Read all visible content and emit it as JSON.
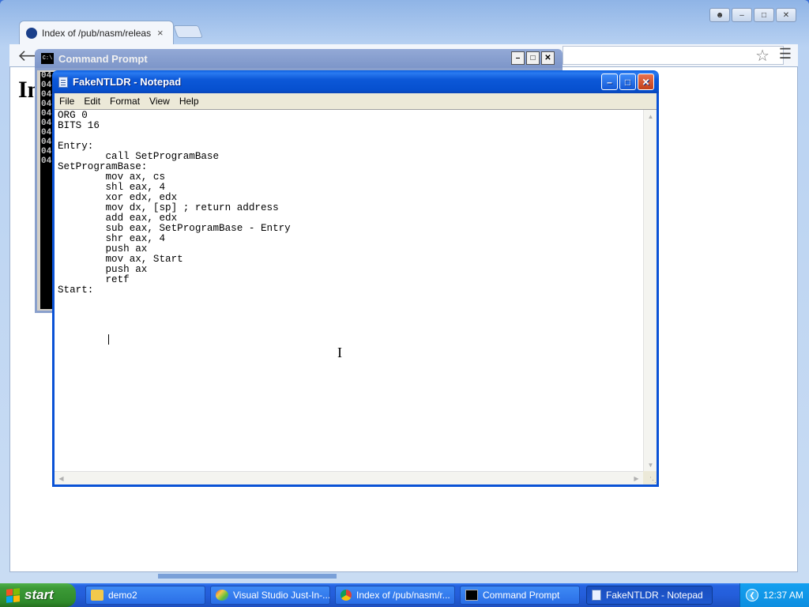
{
  "browser": {
    "tab_title": "Index of /pub/nasm/releasel",
    "tab_close": "×",
    "page_heading": "In",
    "back_icon": "back-arrow-icon",
    "star_icon": "star-icon",
    "menu_icon": "hamburger-menu-icon"
  },
  "cmd": {
    "title": "Command Prompt",
    "icon_text": "C:\\",
    "console_lines": [
      "04",
      "04",
      "04",
      "04",
      "04",
      "04",
      "04",
      "04",
      "04",
      "04"
    ]
  },
  "notepad": {
    "title": "FakeNTLDR - Notepad",
    "menu": [
      "File",
      "Edit",
      "Format",
      "View",
      "Help"
    ],
    "code": "ORG 0\nBITS 16\n\nEntry:\n        call SetProgramBase\nSetProgramBase:\n        mov ax, cs\n        shl eax, 4\n        xor edx, edx\n        mov dx, [sp] ; return address\n        add eax, edx\n        sub eax, SetProgramBase - Entry\n        shr eax, 4\n        push ax\n        mov ax, Start\n        push ax\n        retf\nStart:\n        "
  },
  "taskbar": {
    "start_label": "start",
    "items": [
      {
        "label": "demo2",
        "icon": "folder-icon"
      },
      {
        "label": "Visual Studio Just-In-...",
        "icon": "visual-studio-icon"
      },
      {
        "label": "Index of /pub/nasm/r...",
        "icon": "chrome-icon"
      },
      {
        "label": "Command Prompt",
        "icon": "cmd-icon"
      },
      {
        "label": "FakeNTLDR - Notepad",
        "icon": "notepad-icon"
      }
    ],
    "clock": "12:37 AM"
  },
  "colors": {
    "xp_title_blue": "#0a52d6",
    "start_green": "#3c9a37",
    "taskbar_blue": "#245edb"
  }
}
